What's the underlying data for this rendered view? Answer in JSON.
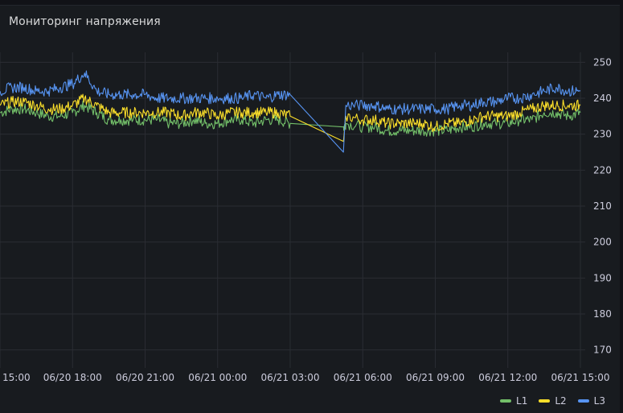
{
  "panel": {
    "title": "Мониторинг напряжения"
  },
  "chart_data": {
    "type": "line",
    "ylim": [
      165,
      255
    ],
    "yticks": [
      170,
      180,
      190,
      200,
      210,
      220,
      230,
      240,
      250
    ],
    "xlim": [
      0,
      24.2
    ],
    "xticks": [
      {
        "x": 0,
        "label": "15:00"
      },
      {
        "x": 3,
        "label": "06/20 18:00"
      },
      {
        "x": 6,
        "label": "06/20 21:00"
      },
      {
        "x": 9,
        "label": "06/21 00:00"
      },
      {
        "x": 12,
        "label": "06/21 03:00"
      },
      {
        "x": 15,
        "label": "06/21 06:00"
      },
      {
        "x": 18,
        "label": "06/21 09:00"
      },
      {
        "x": 21,
        "label": "06/21 12:00"
      },
      {
        "x": 24,
        "label": "06/21 15:00"
      }
    ],
    "grid": true,
    "legend": "bottom-right",
    "series": [
      {
        "name": "L1",
        "color": "#73bf69",
        "points": [
          [
            0,
            236
          ],
          [
            0.5,
            237
          ],
          [
            1,
            237
          ],
          [
            1.5,
            236
          ],
          [
            2,
            235
          ],
          [
            2.5,
            235
          ],
          [
            3,
            236
          ],
          [
            3.5,
            238
          ],
          [
            4,
            236
          ],
          [
            4.5,
            234
          ],
          [
            5,
            234
          ],
          [
            5.5,
            234
          ],
          [
            6,
            234
          ],
          [
            6.5,
            234
          ],
          [
            7,
            233
          ],
          [
            7.5,
            233
          ],
          [
            8,
            234
          ],
          [
            8.5,
            233
          ],
          [
            9,
            233
          ],
          [
            9.5,
            234
          ],
          [
            10,
            234
          ],
          [
            10.5,
            233
          ],
          [
            11,
            234
          ],
          [
            11.5,
            234
          ],
          [
            12,
            233
          ],
          [
            14.2,
            232
          ],
          [
            14.3,
            233
          ],
          [
            15,
            232
          ],
          [
            15.5,
            232
          ],
          [
            16,
            231
          ],
          [
            16.5,
            231
          ],
          [
            17,
            231
          ],
          [
            17.5,
            231
          ],
          [
            18,
            231
          ],
          [
            18.5,
            231
          ],
          [
            19,
            232
          ],
          [
            19.5,
            232
          ],
          [
            20,
            233
          ],
          [
            20.5,
            233
          ],
          [
            21,
            233
          ],
          [
            21.5,
            234
          ],
          [
            22,
            234
          ],
          [
            22.5,
            236
          ],
          [
            23,
            236
          ],
          [
            23.5,
            235
          ],
          [
            24,
            236
          ]
        ]
      },
      {
        "name": "L2",
        "color": "#fade2a",
        "points": [
          [
            0,
            238
          ],
          [
            0.5,
            239
          ],
          [
            1,
            239
          ],
          [
            1.5,
            238
          ],
          [
            2,
            237
          ],
          [
            2.5,
            237
          ],
          [
            3,
            238
          ],
          [
            3.5,
            240
          ],
          [
            4,
            238
          ],
          [
            4.5,
            236
          ],
          [
            5,
            236
          ],
          [
            5.5,
            236
          ],
          [
            6,
            236
          ],
          [
            6.5,
            236
          ],
          [
            7,
            236
          ],
          [
            7.5,
            235
          ],
          [
            8,
            236
          ],
          [
            8.5,
            236
          ],
          [
            9,
            235
          ],
          [
            9.5,
            236
          ],
          [
            10,
            236
          ],
          [
            10.5,
            236
          ],
          [
            11,
            236
          ],
          [
            11.5,
            236
          ],
          [
            12,
            235
          ],
          [
            14.2,
            228
          ],
          [
            14.3,
            235
          ],
          [
            15,
            234
          ],
          [
            15.5,
            234
          ],
          [
            16,
            233
          ],
          [
            16.5,
            233
          ],
          [
            17,
            233
          ],
          [
            17.5,
            233
          ],
          [
            18,
            232
          ],
          [
            18.5,
            233
          ],
          [
            19,
            233
          ],
          [
            19.5,
            234
          ],
          [
            20,
            235
          ],
          [
            20.5,
            235
          ],
          [
            21,
            235
          ],
          [
            21.5,
            236
          ],
          [
            22,
            237
          ],
          [
            22.5,
            238
          ],
          [
            23,
            238
          ],
          [
            23.5,
            238
          ],
          [
            24,
            238
          ]
        ]
      },
      {
        "name": "L3",
        "color": "#5794f2",
        "points": [
          [
            0,
            242
          ],
          [
            0.5,
            243
          ],
          [
            1,
            243
          ],
          [
            1.5,
            242
          ],
          [
            2,
            242
          ],
          [
            2.5,
            243
          ],
          [
            3,
            244
          ],
          [
            3.5,
            247
          ],
          [
            4,
            242
          ],
          [
            4.5,
            241
          ],
          [
            5,
            241
          ],
          [
            5.5,
            241
          ],
          [
            6,
            241
          ],
          [
            6.5,
            240
          ],
          [
            7,
            240
          ],
          [
            7.5,
            240
          ],
          [
            8,
            240
          ],
          [
            8.5,
            240
          ],
          [
            9,
            240
          ],
          [
            9.5,
            240
          ],
          [
            10,
            240
          ],
          [
            10.5,
            241
          ],
          [
            11,
            240
          ],
          [
            11.5,
            241
          ],
          [
            12,
            241
          ],
          [
            14.2,
            225
          ],
          [
            14.3,
            238
          ],
          [
            15,
            238
          ],
          [
            15.5,
            238
          ],
          [
            16,
            237
          ],
          [
            16.5,
            237
          ],
          [
            17,
            237
          ],
          [
            17.5,
            237
          ],
          [
            18,
            237
          ],
          [
            18.5,
            237
          ],
          [
            19,
            238
          ],
          [
            19.5,
            238
          ],
          [
            20,
            239
          ],
          [
            20.5,
            239
          ],
          [
            21,
            240
          ],
          [
            21.5,
            240
          ],
          [
            22,
            241
          ],
          [
            22.5,
            242
          ],
          [
            23,
            243
          ],
          [
            23.5,
            242
          ],
          [
            24,
            242
          ]
        ]
      }
    ]
  }
}
